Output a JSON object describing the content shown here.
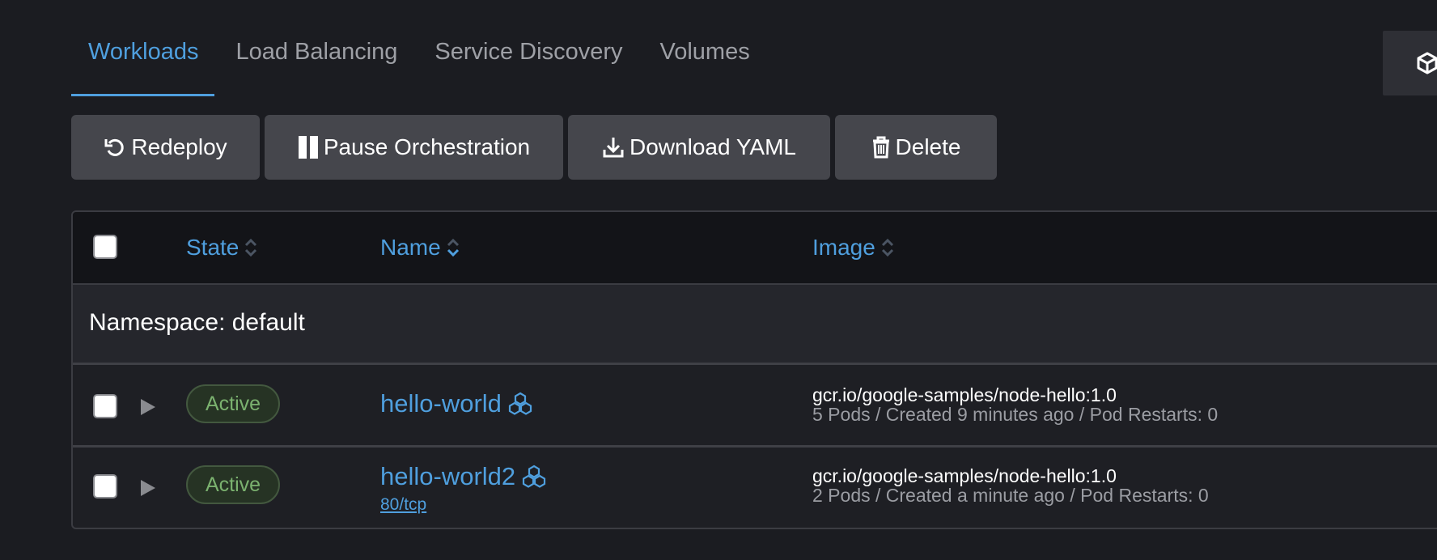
{
  "tabs": [
    {
      "label": "Workloads",
      "active": true
    },
    {
      "label": "Load Balancing",
      "active": false
    },
    {
      "label": "Service Discovery",
      "active": false
    },
    {
      "label": "Volumes",
      "active": false
    }
  ],
  "actions": {
    "redeploy": "Redeploy",
    "pause": "Pause Orchestration",
    "download": "Download YAML",
    "delete": "Delete"
  },
  "table": {
    "headers": {
      "state": "State",
      "name": "Name",
      "image": "Image"
    },
    "group_label": "Namespace: default",
    "rows": [
      {
        "state": "Active",
        "name": "hello-world",
        "port": "",
        "image": "gcr.io/google-samples/node-hello:1.0",
        "meta": "5 Pods / Created 9 minutes ago / Pod Restarts: 0"
      },
      {
        "state": "Active",
        "name": "hello-world2",
        "port": "80/tcp",
        "image": "gcr.io/google-samples/node-hello:1.0",
        "meta": "2 Pods / Created a minute ago / Pod Restarts: 0"
      }
    ]
  },
  "colors": {
    "accent": "#4f9fde",
    "background": "#1b1c21",
    "active_badge_text": "#7bb26f"
  }
}
